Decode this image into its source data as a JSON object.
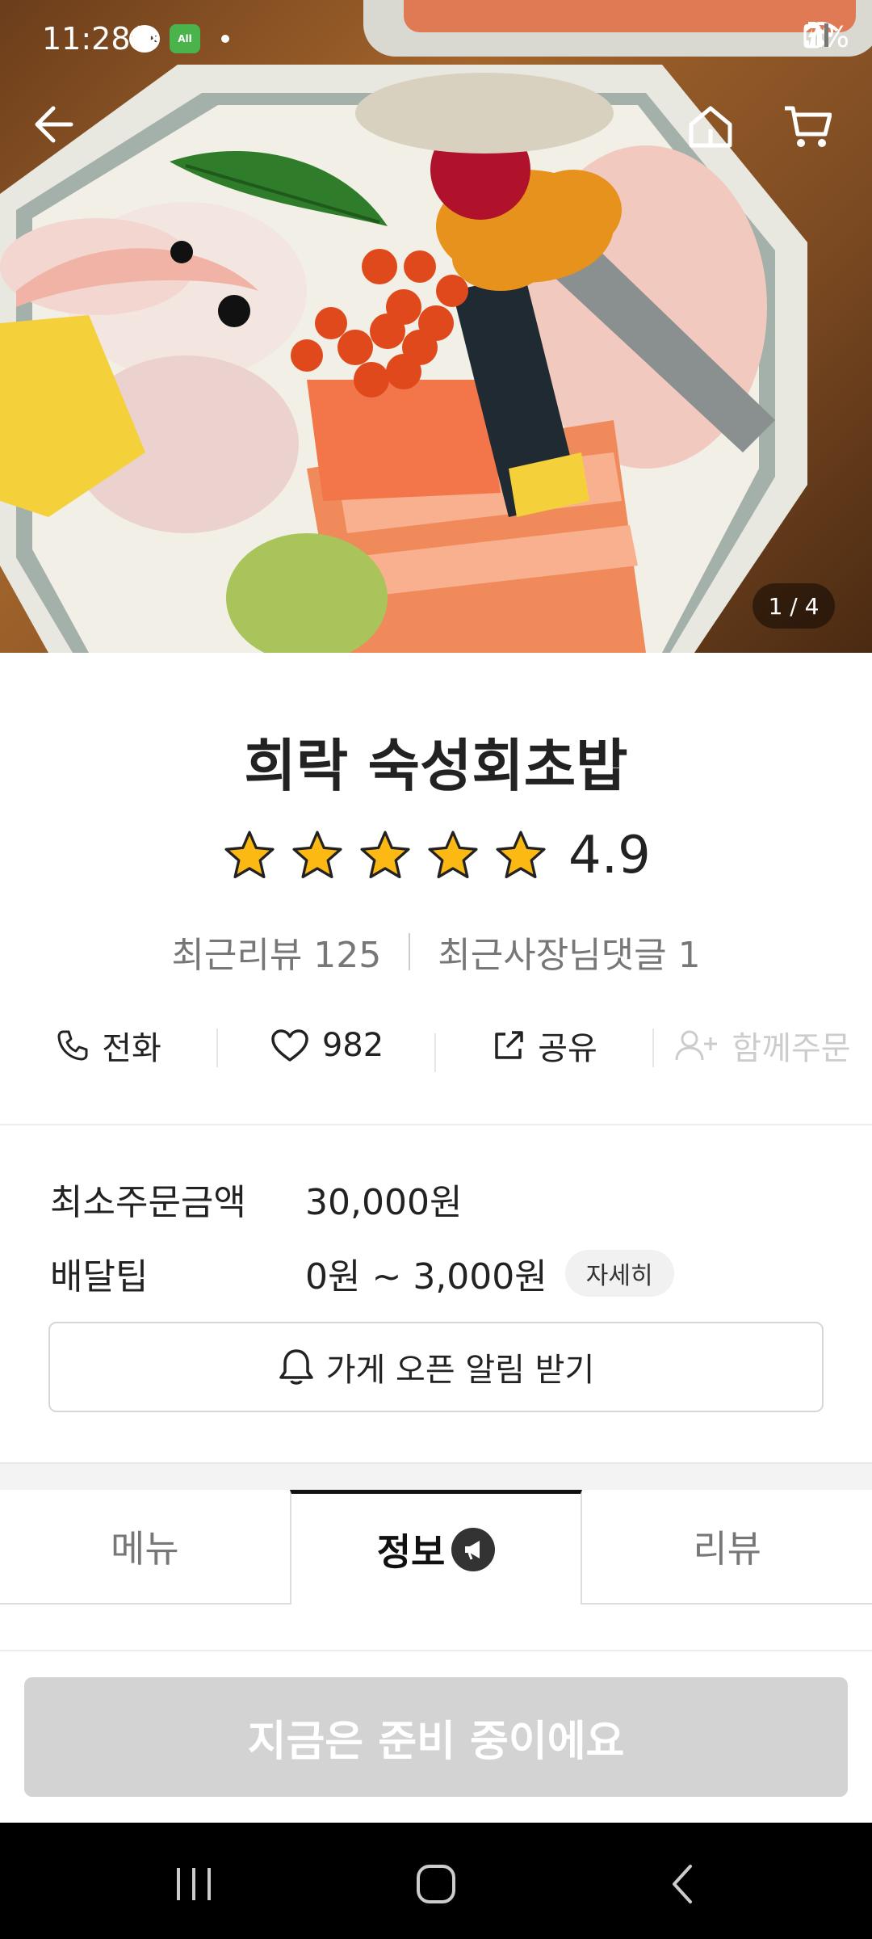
{
  "status_bar": {
    "time": "11:28",
    "talk_badge": "TALK",
    "all_badge": "All",
    "battery": "7%"
  },
  "hero": {
    "page_indicator": "1 / 4"
  },
  "store": {
    "name": "희락 숙성회초밥",
    "rating": "4.9",
    "stars_filled": 5,
    "recent_reviews": "최근리뷰 125",
    "owner_replies": "최근사장님댓글 1"
  },
  "actions": {
    "call": "전화",
    "likes": "982",
    "share": "공유",
    "group_order": "함께주문"
  },
  "info": {
    "min_order_label": "최소주문금액",
    "min_order_value": "30,000원",
    "delivery_tip_label": "배달팁",
    "delivery_tip_value": "0원 ~ 3,000원",
    "detail_button": "자세히"
  },
  "notify_button": "가게 오픈 알림 받기",
  "tabs": [
    {
      "label": "메뉴",
      "active": false
    },
    {
      "label": "정보",
      "active": true
    },
    {
      "label": "리뷰",
      "active": false
    }
  ],
  "order_button": "지금은 준비 중이에요",
  "colors": {
    "star": "#FDB913",
    "disabled_button": "#D3D3D3",
    "nav_bar": "#000000"
  }
}
